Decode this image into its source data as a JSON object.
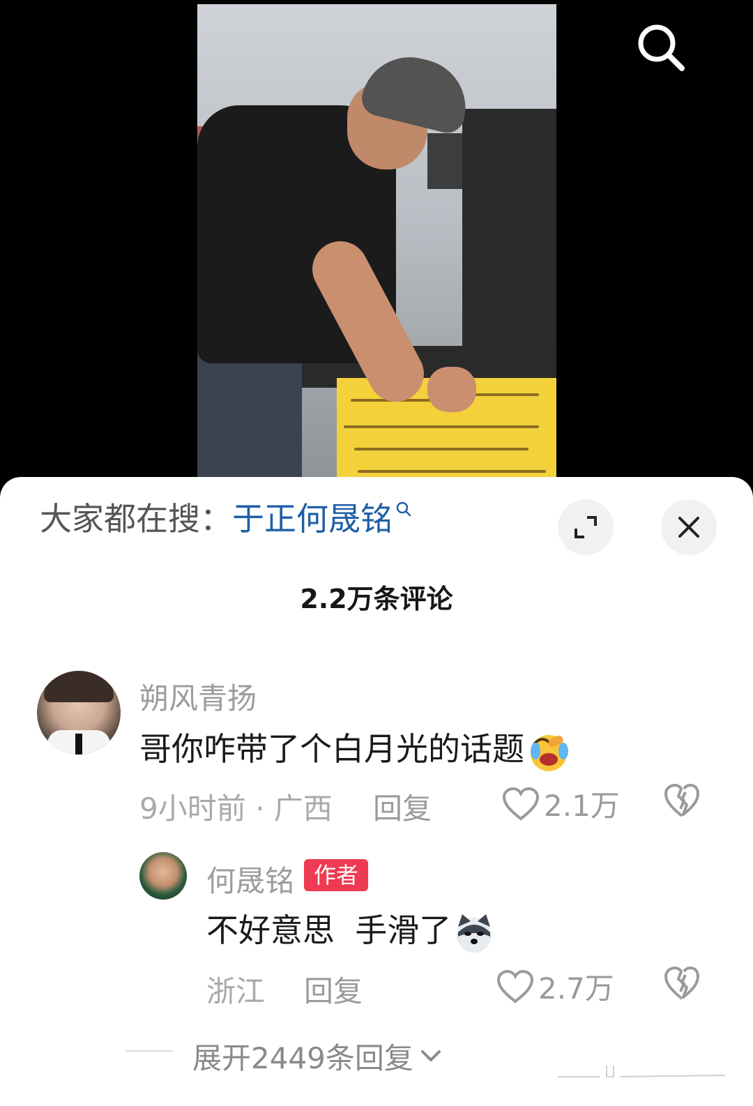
{
  "video": {
    "search_icon": "search-icon"
  },
  "sheet": {
    "search_hint": {
      "prefix": "大家都在搜：",
      "term": "于正何晟铭",
      "icon": "search-icon"
    },
    "expand_icon": "expand-icon",
    "close_icon": "close-icon",
    "comment_count": "2.2万条评论"
  },
  "comments": [
    {
      "author": "朔风青扬",
      "text": "哥你咋带了个白月光的话题",
      "emoji": "laughing-crying-emoji",
      "time_location": "9小时前 · 广西",
      "reply_label": "回复",
      "likes": "2.1万",
      "dislike_icon": "broken-heart-icon"
    }
  ],
  "replies": [
    {
      "author": "何晟铭",
      "badge": "作者",
      "text": "不好意思  手滑了",
      "emoji": "dog-emoji",
      "location": "浙江",
      "reply_label": "回复",
      "likes": "2.7万",
      "dislike_icon": "broken-heart-icon"
    }
  ],
  "expand_replies": {
    "label": "展开2449条回复",
    "icon": "chevron-down-icon"
  },
  "colors": {
    "accent_link": "#1f5fa6",
    "author_badge": "#ee3a52",
    "background_video": "#000000",
    "sheet": "#ffffff"
  }
}
